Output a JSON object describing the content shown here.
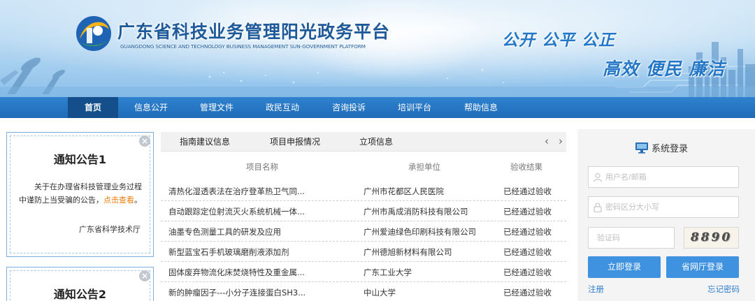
{
  "header": {
    "title": "广东省科技业务管理阳光政务平台",
    "subtitle": "GUANGDONG SCIENCE AND TECHNOLOGY BUSINESS MANAGEMENT SUN-GOVERNMENT PLATFORM",
    "slogan_line1": "公开 公平 公正",
    "slogan_line2": "高效 便民 廉洁"
  },
  "nav": {
    "items": [
      {
        "label": "首页",
        "active": true
      },
      {
        "label": "信息公开"
      },
      {
        "label": "管理文件"
      },
      {
        "label": "政民互动"
      },
      {
        "label": "咨询投诉"
      },
      {
        "label": "培训平台"
      },
      {
        "label": "帮助信息"
      }
    ]
  },
  "notices": [
    {
      "title": "通知公告1",
      "body": "关于在办理省科技管理业务过程中谨防上当受骗的公告，",
      "link": "点击查看",
      "suffix": "。",
      "signature": "广东省科学技术厅"
    },
    {
      "title": "通知公告2"
    }
  ],
  "tabs": {
    "items": [
      "指南建议信息",
      "项目申报情况",
      "立项信息"
    ],
    "prev": "‹",
    "next": "›"
  },
  "table": {
    "headers": [
      "项目名称",
      "承担单位",
      "验收结果"
    ],
    "rows": [
      [
        "清热化湿透表法在治疗登革热卫气同...",
        "广州市花都区人民医院",
        "已经通过验收"
      ],
      [
        "自动跟踪定位射流灭火系统机械一体...",
        "广州市禹成消防科技有限公司",
        "已经通过验收"
      ],
      [
        "油墨专色测量工具的研发及应用",
        "广州爱迪绿色印刷科技有限公司",
        "已经通过验收"
      ],
      [
        "新型蓝宝石手机玻璃磨削液添加剂",
        "广州德旭新材料有限公司",
        "已经通过验收"
      ],
      [
        "固体废弃物流化床焚烧特性及重金属...",
        "广东工业大学",
        "已经通过验收"
      ],
      [
        "新的肿瘤因子---小分子连接蛋白SH3...",
        "中山大学",
        "已经通过验收"
      ]
    ]
  },
  "login": {
    "title": "系统登录",
    "username_placeholder": "用户名/邮箱",
    "password_placeholder": "密码区分大小写",
    "captcha_placeholder": "验证码",
    "captcha_text": "8890",
    "login_button": "立即登录",
    "hall_login_button": "省网厅登录",
    "register_link": "注册",
    "forgot_link": "忘记密码"
  },
  "colors": {
    "nav_bg": "#2f82cf",
    "nav_active": "#144f8c",
    "accent_button": "#3f92e0",
    "link_orange": "#ef7d0e",
    "title_blue": "#1e5a9a"
  }
}
